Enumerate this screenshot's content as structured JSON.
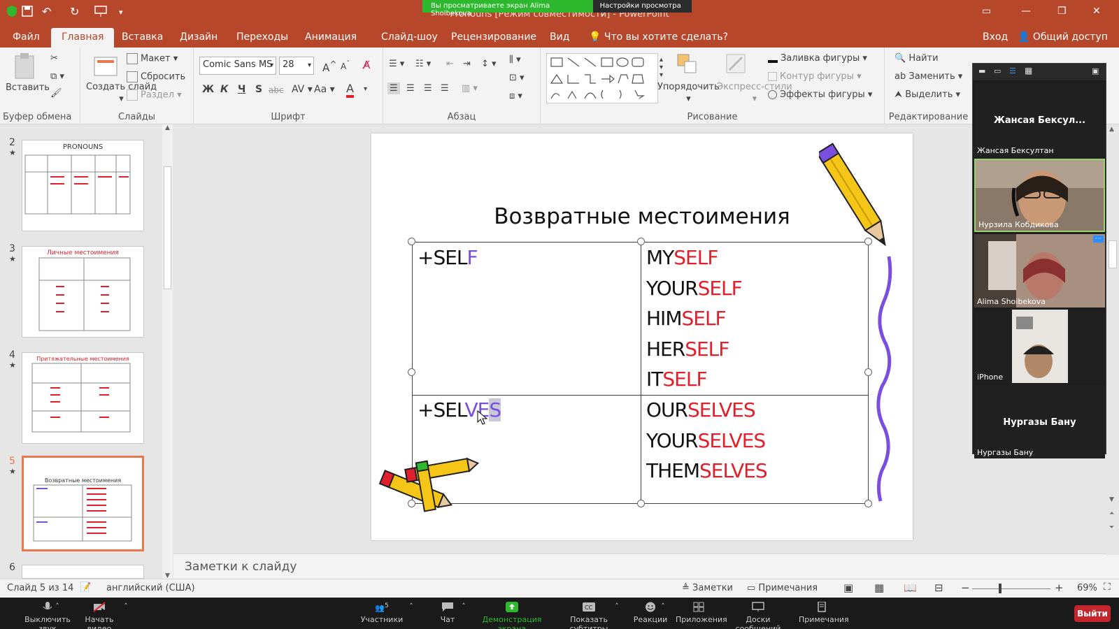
{
  "window": {
    "title": "Pronouns [Режим совместимости] - PowerPoint"
  },
  "zoom_share": {
    "viewing_label": "Вы просматриваете экран Alima Shoibekova",
    "view_settings_label": "Настройки просмотра"
  },
  "menu": {
    "tabs": [
      "Файл",
      "Главная",
      "Вставка",
      "Дизайн",
      "Переходы",
      "Анимация",
      "Слайд-шоу",
      "Рецензирование",
      "Вид"
    ],
    "active": "Главная",
    "tell_me": "Что вы хотите сделать?",
    "signin": "Вход",
    "share": "Общий доступ"
  },
  "ribbon": {
    "clipboard": {
      "label": "Буфер обмена",
      "paste": "Вставить"
    },
    "slides": {
      "label": "Слайды",
      "new_slide": "Создать слайд",
      "layout": "Макет",
      "reset": "Сбросить",
      "section": "Раздел"
    },
    "font": {
      "label": "Шрифт",
      "font_name": "Comic Sans MS",
      "font_size": "28",
      "bold": "Ж",
      "italic": "К",
      "underline": "Ч",
      "shadow": "S",
      "strike": "abc",
      "case": "Aa"
    },
    "paragraph": {
      "label": "Абзац"
    },
    "drawing": {
      "label": "Рисование",
      "arrange": "Упорядочить",
      "quick_styles": "Экспресс-стили",
      "fill": "Заливка фигуры",
      "outline": "Контур фигуры",
      "effects": "Эффекты фигуры"
    },
    "editing": {
      "label": "Редактирование",
      "find": "Найти",
      "replace": "Заменить",
      "select": "Выделить"
    }
  },
  "thumbnails": [
    {
      "num": "2",
      "title": "PRONOUNS"
    },
    {
      "num": "3",
      "title": "Личные местоимения"
    },
    {
      "num": "4",
      "title": "Притяжательные местоимения"
    },
    {
      "num": "5",
      "title": "Возвратные местоимения",
      "selected": true
    },
    {
      "num": "6",
      "title": ""
    }
  ],
  "slide": {
    "title": "Возвратные местоимения",
    "row1": {
      "left_black": "+SEL",
      "left_purple": "F",
      "items": [
        {
          "b": "MY",
          "r": "SELF"
        },
        {
          "b": "YOUR",
          "r": "SELF"
        },
        {
          "b": "HIM",
          "r": "SELF"
        },
        {
          "b": "HER",
          "r": "SELF"
        },
        {
          "b": "IT",
          "r": "SELF"
        }
      ]
    },
    "row2": {
      "left_black": "+SEL",
      "left_purple": "VE",
      "left_hl": "S",
      "items": [
        {
          "b": "OUR",
          "r": "SELVES"
        },
        {
          "b": "YOUR",
          "r": "SELVES"
        },
        {
          "b": "THEM",
          "r": "SELVES"
        }
      ]
    }
  },
  "notes": {
    "placeholder": "Заметки к слайду"
  },
  "status": {
    "slide_info": "Слайд 5 из 14",
    "language": "английский (США)",
    "notes_btn": "Заметки",
    "comments_btn": "Примечания",
    "zoom": "69%"
  },
  "participants": [
    {
      "big": "Жансая Бексул...",
      "name": "Жансая Бексултан",
      "video": false
    },
    {
      "name": "Нурзила Кобдикова",
      "video": true
    },
    {
      "name": "Alima Shoibekova",
      "video": true
    },
    {
      "name": "iPhone",
      "video": true
    },
    {
      "big": "Нургазы Бану",
      "name": "Нургазы Бану",
      "video": false
    }
  ],
  "zoom_toolbar": {
    "mute": "Выключить звук",
    "video": "Начать видео",
    "participants": "Участники",
    "participants_count": "5",
    "chat": "Чат",
    "share": "Демонстрация экрана",
    "captions": "Показать субтитры",
    "reactions": "Реакции",
    "apps": "Приложения",
    "whiteboards": "Доски сообщений",
    "notes": "Примечания",
    "leave": "Выйти"
  },
  "colors": {
    "ppt_red": "#b7472a",
    "accent_red": "#e0202c",
    "accent_purple": "#7a4fe0",
    "zoom_green": "#2eb82e"
  }
}
